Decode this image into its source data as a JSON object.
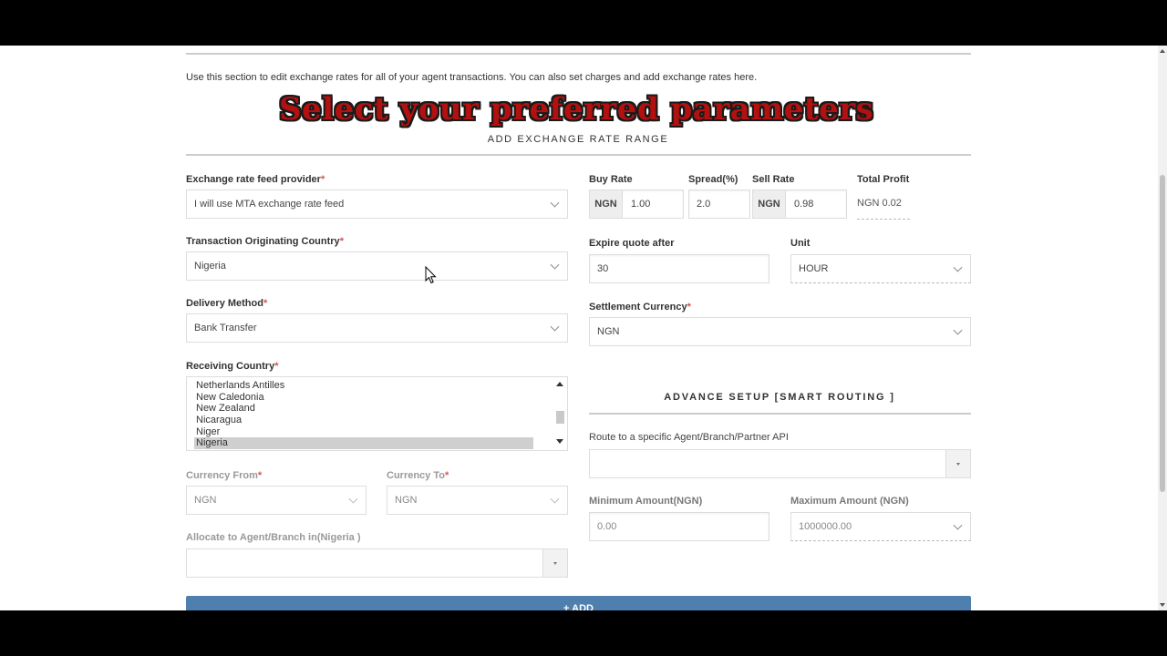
{
  "intro_text": "Use this section to edit exchange rates for all of your agent transactions. You can also set charges and add exchange rates here.",
  "overlay_title": "Select your preferred parameters",
  "section_add_title": "ADD EXCHANGE RATE RANGE",
  "left": {
    "feed_provider": {
      "label": "Exchange rate feed provider",
      "value": "I will use MTA exchange rate feed"
    },
    "originating_country": {
      "label": "Transaction Originating Country",
      "value": "Nigeria"
    },
    "delivery_method": {
      "label": "Delivery Method",
      "value": "Bank Transfer"
    },
    "receiving_country": {
      "label": "Receiving Country",
      "options": [
        "Netherlands Antilles",
        "New Caledonia",
        "New Zealand",
        "Nicaragua",
        "Niger",
        "Nigeria"
      ],
      "selected": "Nigeria"
    },
    "currency_from": {
      "label": "Currency From",
      "value": "NGN"
    },
    "currency_to": {
      "label": "Currency To",
      "value": "NGN"
    },
    "allocate": {
      "label": "Allocate to Agent/Branch in(Nigeria )",
      "value": ""
    }
  },
  "right": {
    "buy_rate": {
      "label": "Buy Rate",
      "currency": "NGN",
      "value": "1.00"
    },
    "spread": {
      "label": "Spread(%)",
      "value": "2.0"
    },
    "sell_rate": {
      "label": "Sell Rate",
      "currency": "NGN",
      "value": "0.98"
    },
    "total_profit": {
      "label": "Total Profit",
      "value": "NGN 0.02"
    },
    "expire_quote": {
      "label": "Expire quote after",
      "value": "30"
    },
    "unit": {
      "label": "Unit",
      "value": "HOUR"
    },
    "settlement_currency": {
      "label": "Settlement Currency",
      "value": "NGN"
    },
    "advance_title": "ADVANCE SETUP [SMART ROUTING ]",
    "route": {
      "label": "Route to a specific Agent/Branch/Partner API",
      "value": ""
    },
    "min_amount": {
      "label": "Minimum Amount(NGN)",
      "value": "0.00"
    },
    "max_amount": {
      "label": "Maximum Amount (NGN)",
      "value": "1000000.00"
    }
  },
  "required_mark": "*",
  "add_button": "+ ADD"
}
